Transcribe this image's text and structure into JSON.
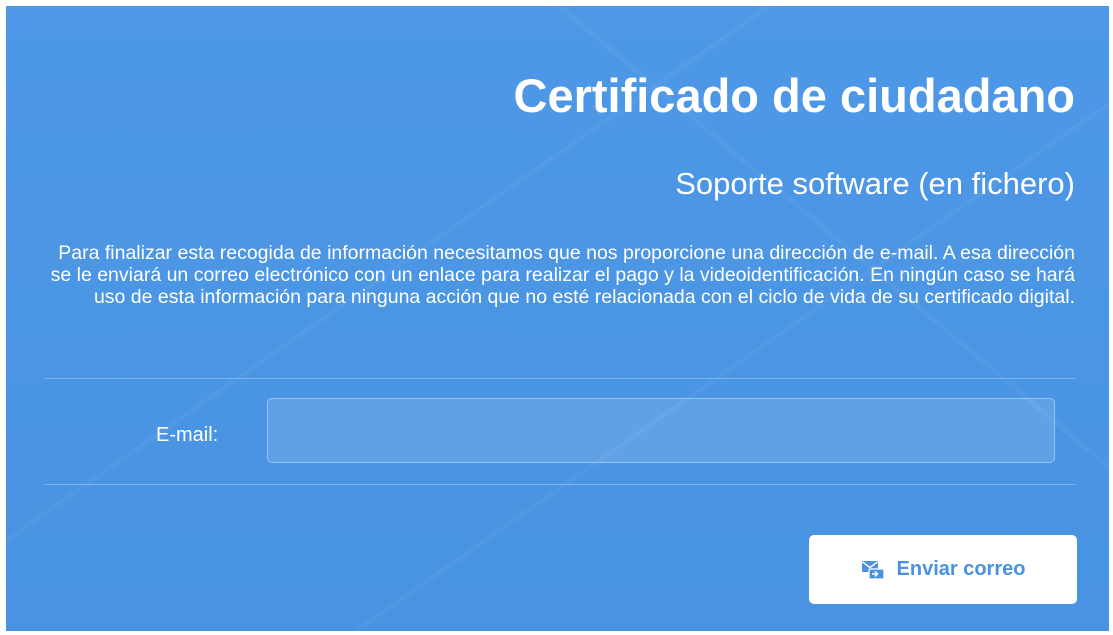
{
  "header": {
    "title": "Certificado de ciudadano",
    "subtitle": "Soporte software (en fichero)"
  },
  "intro": {
    "text": "Para finalizar esta recogida de información necesitamos que nos proporcione una dirección de e-mail. A esa dirección se le enviará un correo electrónico con un enlace para realizar el pago y la videoidentificación. En ningún caso se hará uso de esta información para ninguna acción que no esté relacionada con el ciclo de vida de su certificado digital."
  },
  "form": {
    "email_label": "E-mail:",
    "email_value": "",
    "email_placeholder": ""
  },
  "actions": {
    "send_label": "Enviar correo",
    "send_icon": "mail-send-icon"
  },
  "colors": {
    "background": "#4a96e6",
    "text": "#ffffff",
    "button_background": "#ffffff",
    "button_text": "#4a91de"
  }
}
